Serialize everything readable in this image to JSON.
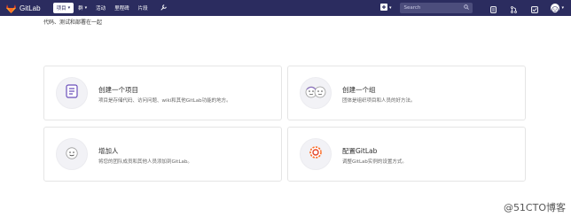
{
  "navbar": {
    "brand": "GitLab",
    "items": [
      {
        "label": "项目",
        "caret": "▾"
      },
      {
        "label": "群",
        "caret": "▾"
      },
      {
        "label": "活动"
      },
      {
        "label": "里程碑"
      },
      {
        "label": "片段"
      }
    ],
    "plus_caret": "▾",
    "search_placeholder": "Search",
    "avatar_caret": "▾"
  },
  "tagline": "代码、测试和部署在一起",
  "cards": [
    {
      "title": "创建一个项目",
      "desc": "项目是存储代码、访问问题、wiki和其他GitLab功能的地方。",
      "icon": "project-icon"
    },
    {
      "title": "创建一个组",
      "desc": "团体是组织项目和人员的好方法。",
      "icon": "group-icon"
    },
    {
      "title": "增加人",
      "desc": "将您的团队成员和其他人员添加到GitLab。",
      "icon": "user-icon"
    },
    {
      "title": "配置GitLab",
      "desc": "调整GitLab实例的设置方式。",
      "icon": "settings-icon"
    }
  ],
  "watermark": "@51CTO博客",
  "colors": {
    "navbar": "#2b2c5f",
    "accent": "#e24329"
  }
}
